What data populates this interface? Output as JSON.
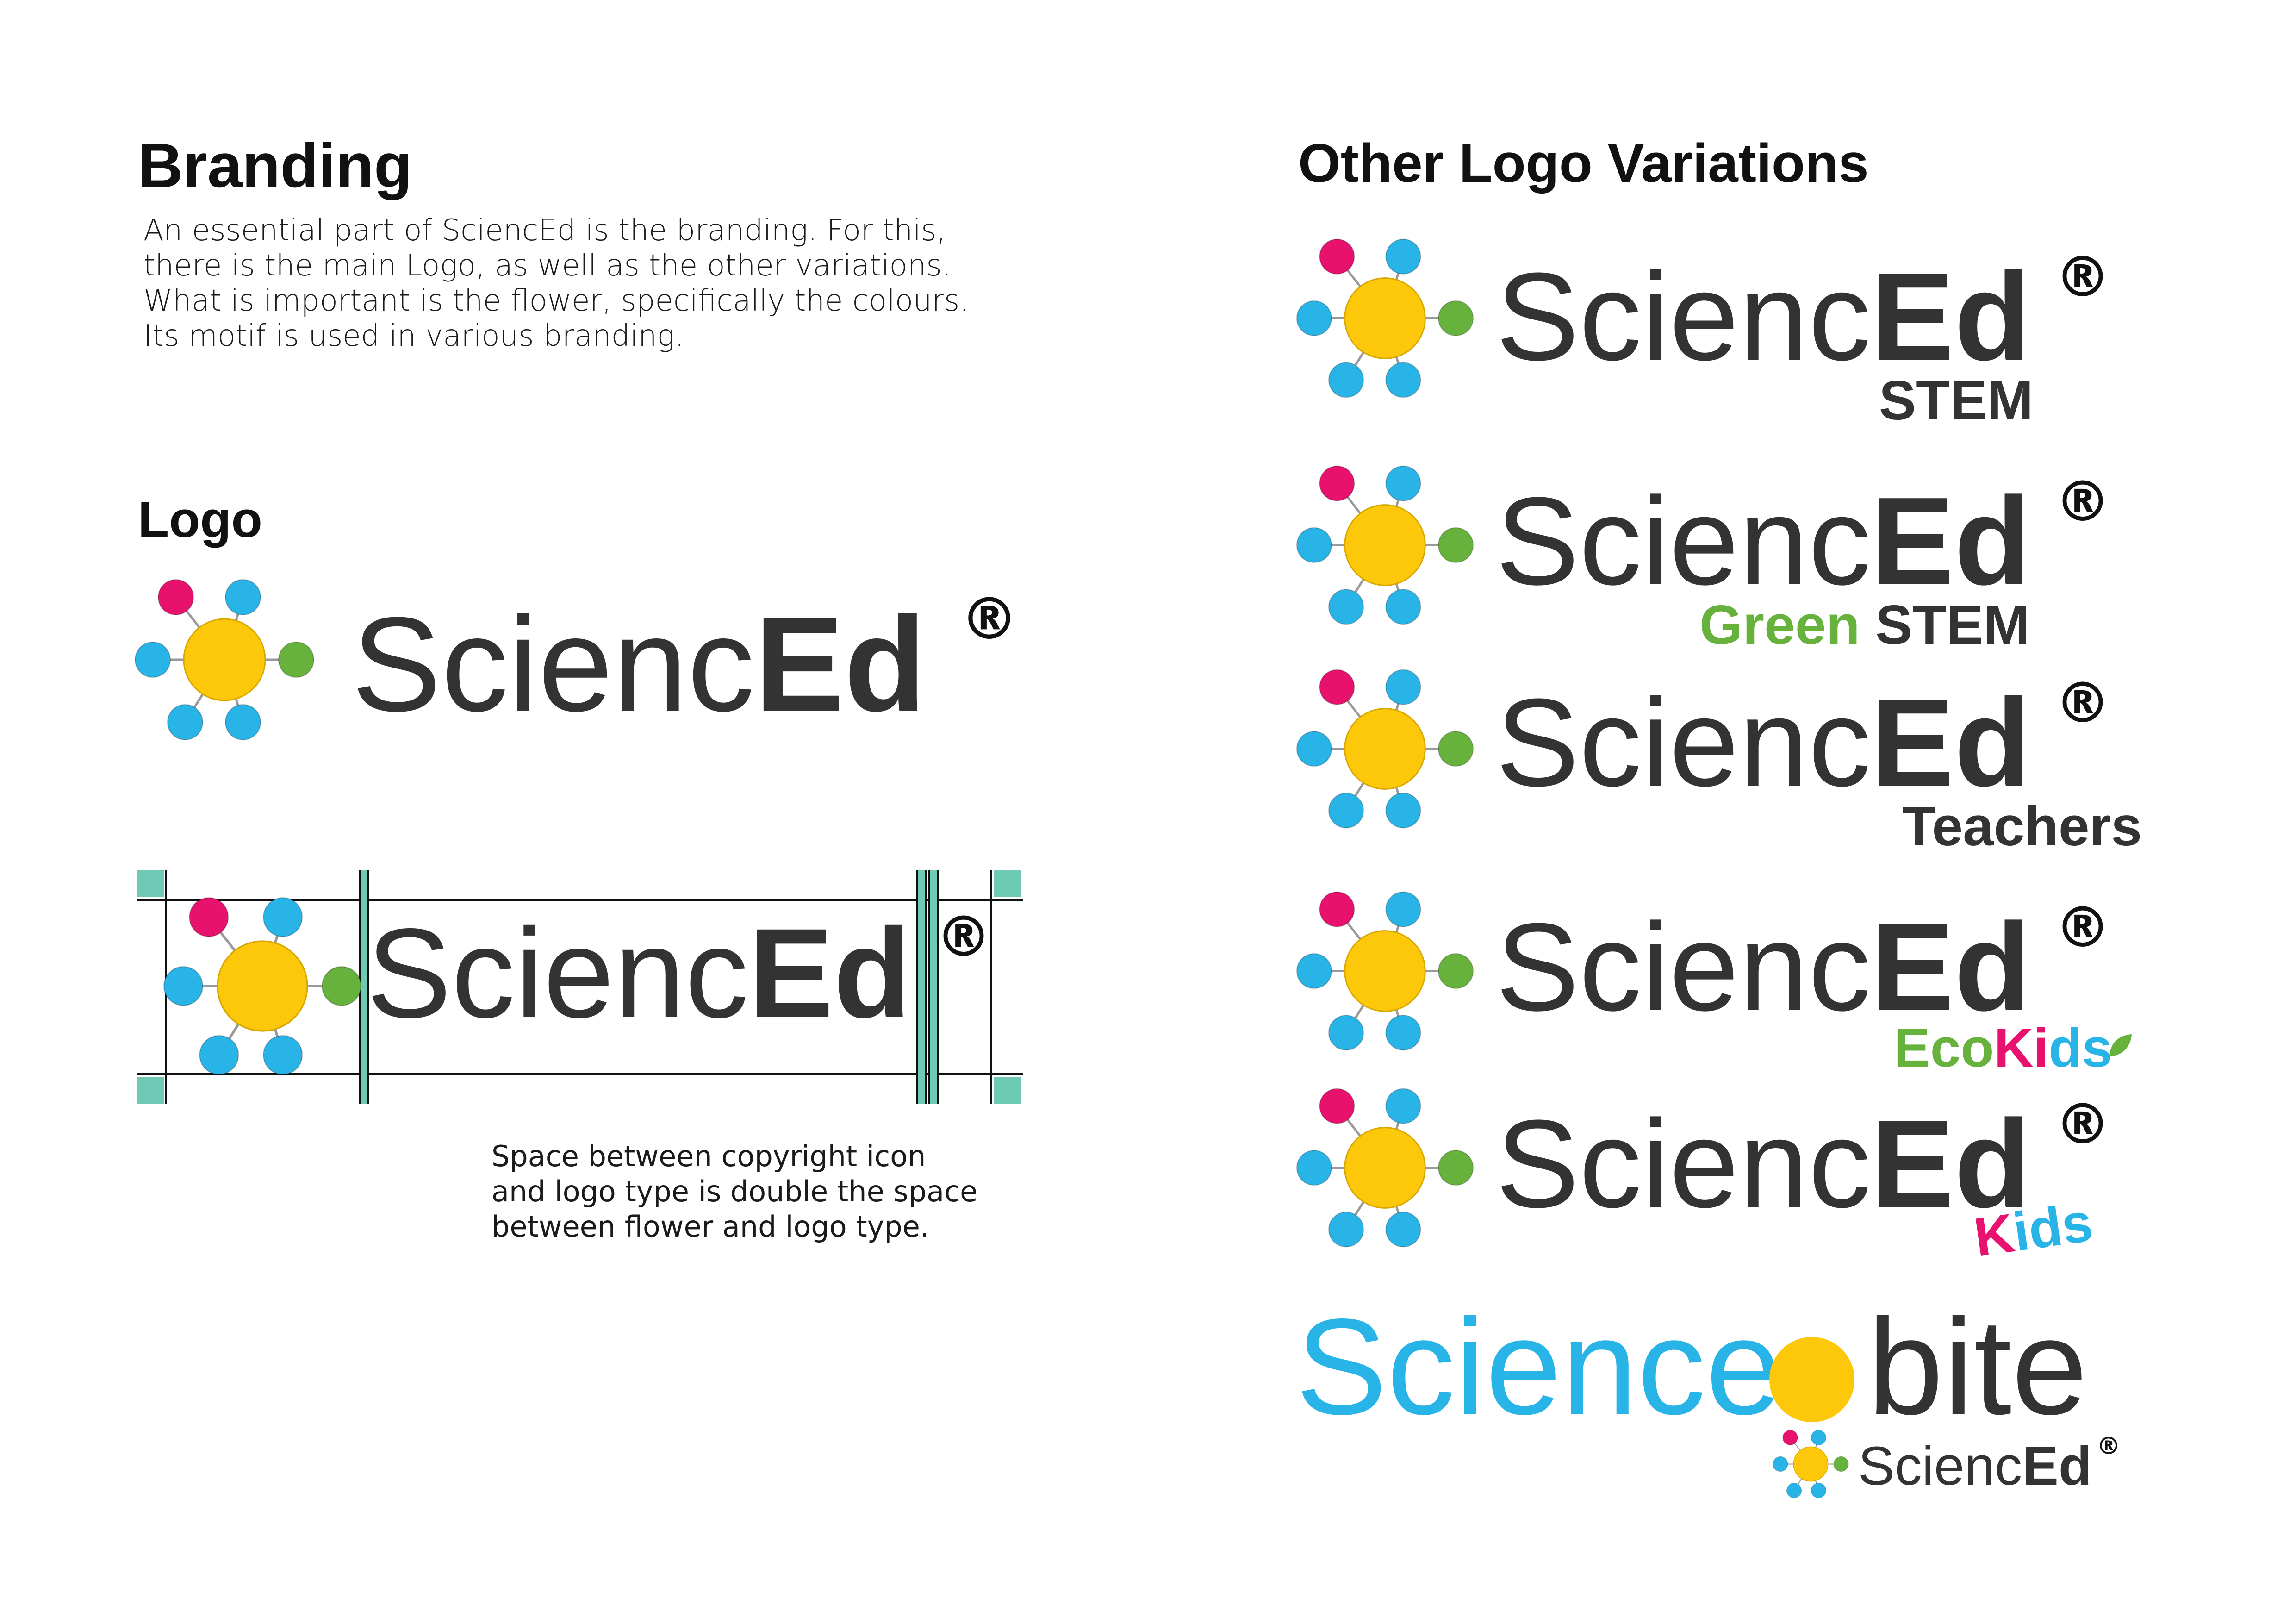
{
  "branding": {
    "title": "Branding",
    "intro_lines": [
      "An essential part of SciencEd is the branding. For this,",
      "there is the main Logo, as well as the other variations.",
      "What is important is the flower, specifically the colours.",
      "Its motif is used in various branding."
    ]
  },
  "logo_section": {
    "title": "Logo",
    "note_lines": [
      "Space between copyright icon",
      "and logo type is double the space",
      "between flower and logo type."
    ]
  },
  "logo": {
    "word_regular": "Scienc",
    "word_bold": "Ed",
    "registered": "®"
  },
  "other": {
    "title": "Other Logo Variations",
    "variants": [
      {
        "sub_parts": [
          {
            "text": "STEM",
            "tone": "dark"
          }
        ]
      },
      {
        "sub_parts": [
          {
            "text": "Green",
            "tone": "green"
          },
          {
            "text": " STEM",
            "tone": "dark"
          }
        ]
      },
      {
        "sub_parts": [
          {
            "text": "Teachers",
            "tone": "dark"
          }
        ]
      },
      {
        "sub_parts": [
          {
            "text": "Eco",
            "tone": "green"
          },
          {
            "text": "Ki",
            "tone": "pink"
          },
          {
            "text": "ds",
            "tone": "blue"
          }
        ]
      },
      {
        "sub_parts": [
          {
            "text": "K",
            "tone": "pink"
          },
          {
            "text": "i",
            "tone": "blue"
          },
          {
            "text": "ds",
            "tone": "blue"
          }
        ]
      }
    ],
    "sciencebite": {
      "word_left": "Science",
      "word_right": "bite"
    }
  },
  "colors": {
    "petal_blue": "#29b4e8",
    "petal_pink": "#e8116e",
    "petal_green": "#67b23c",
    "center_yellow": "#fdc80a",
    "text_dark": "#333333",
    "guide_teal": "#6ec9b5"
  }
}
